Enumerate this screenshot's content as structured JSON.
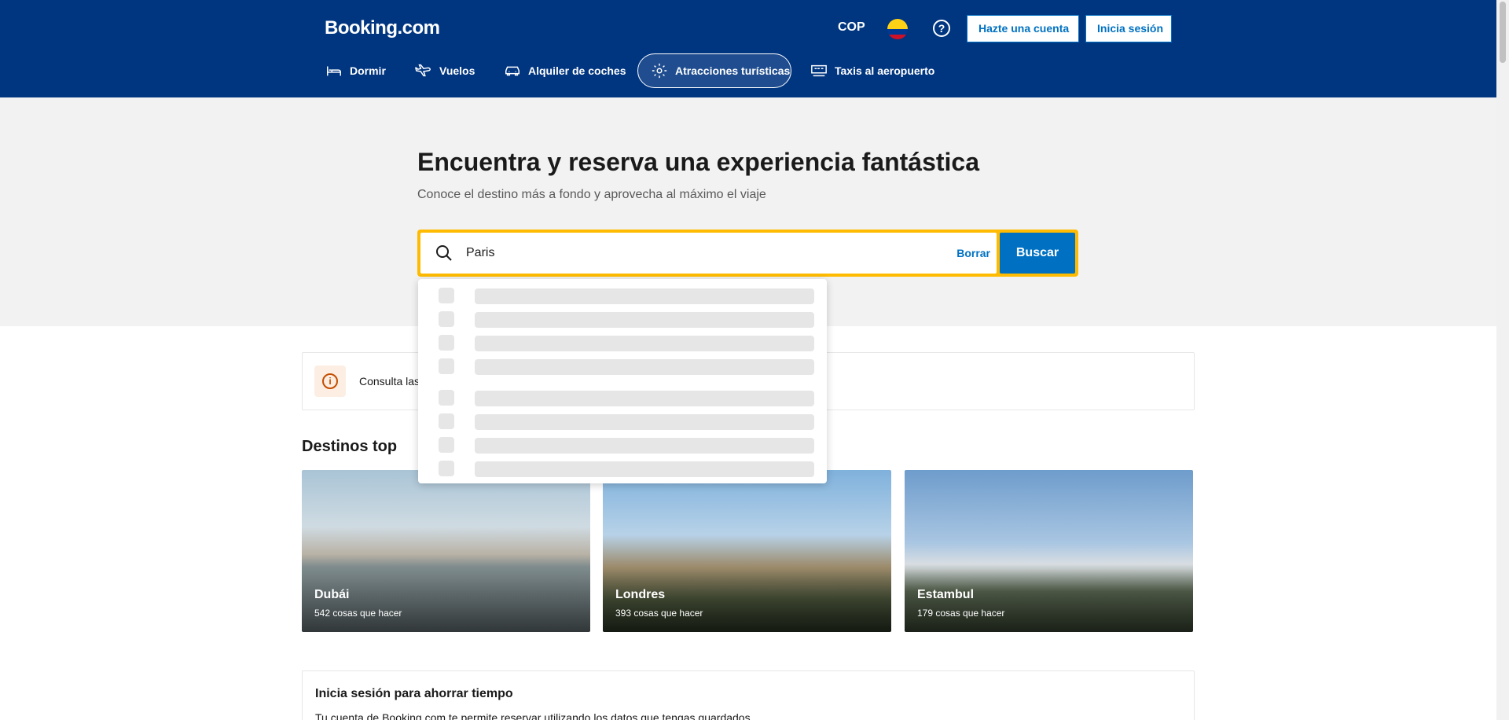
{
  "header": {
    "logo": "Booking.com",
    "currency": "COP",
    "register_label": "Hazte una cuenta",
    "login_label": "Inicia sesión"
  },
  "nav": {
    "stays": "Dormir",
    "flights": "Vuelos",
    "cars": "Alquiler de coches",
    "attractions": "Atracciones turísticas",
    "taxis": "Taxis al aeropuerto"
  },
  "hero": {
    "title": "Encuentra y reserva una experiencia fantástica",
    "subtitle": "Conoce el destino más a fondo y aprovecha al máximo el viaje"
  },
  "search": {
    "value": "Paris",
    "clear_label": "Borrar",
    "button_label": "Buscar"
  },
  "notice": {
    "text": "Consulta las"
  },
  "destinations": {
    "title": "Destinos top",
    "cards": [
      {
        "name": "Dubái",
        "count": "542 cosas que hacer"
      },
      {
        "name": "Londres",
        "count": "393 cosas que hacer"
      },
      {
        "name": "Estambul",
        "count": "179 cosas que hacer"
      }
    ]
  },
  "signin": {
    "title": "Inicia sesión para ahorrar tiempo",
    "text": "Tu cuenta de Booking.com te permite reservar utilizando los datos que tengas guardados."
  },
  "colors": {
    "brand": "#003580",
    "accent_yellow": "#febb02",
    "primary_blue": "#0071c2"
  }
}
